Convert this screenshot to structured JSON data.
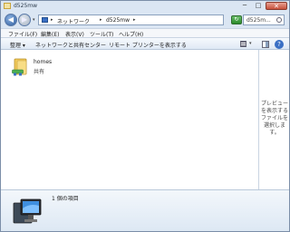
{
  "window": {
    "title": "d525mw"
  },
  "title_buttons": {
    "minimize": "─",
    "maximize": "□",
    "close": "✕"
  },
  "address": {
    "crumbs": [
      "ネットワーク",
      "d525mw"
    ],
    "separator": "▸",
    "search_placeholder": "d525m..."
  },
  "menu": [
    "ファイル(F)",
    "編集(E)",
    "表示(V)",
    "ツール(T)",
    "ヘルプ(H)"
  ],
  "toolbar": {
    "organize": "整理 ▾",
    "network_center": "ネットワークと共有センター",
    "remote_printers": "リモート プリンターを表示する",
    "help": "?"
  },
  "items": [
    {
      "name": "homes",
      "type": "共有",
      "icon": "shared-folder-icon"
    }
  ],
  "preview": {
    "text": "プレビュー\nを表示する\nファイルを\n選択しま\nす。"
  },
  "details": {
    "count": "1 個の項目",
    "icon": "computer-icon"
  },
  "colors": {
    "accent": "#3a6fc4",
    "chrome": "#dbe6f3"
  }
}
